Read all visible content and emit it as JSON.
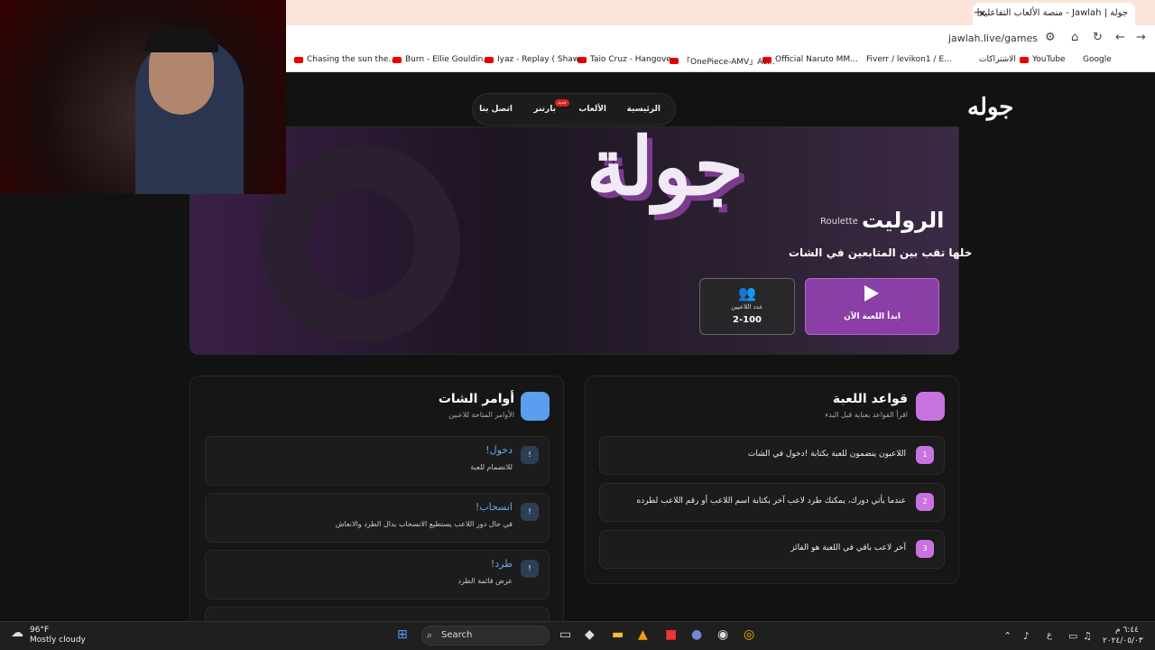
{
  "browser": {
    "tab_title": "جولة | Jawlah - منصة الألعاب التفاعلية",
    "tab_close": "✕",
    "new_tab": "+",
    "url": "jawlah.live/games",
    "bookmarks": [
      "Google",
      "YouTube",
      "الاشتراكات",
      "Fiverr / levikon1 / E...",
      "Official Naruto MM...",
      "「OnePiece-AMV」Ac...",
      "Taio Cruz - Hangove...",
      "Iyaz - Replay ( Shaw...",
      "Burn - Ellie Gouldin...",
      "Chasing the sun the..."
    ]
  },
  "site": {
    "logo": "جوله",
    "nav": [
      "الرئيسية",
      "الألعاب",
      "بارتنر",
      "اتصل بنا"
    ],
    "badge": "جديد"
  },
  "hero": {
    "watermark": "جولة",
    "title": "الروليت",
    "title_en": "Roulette",
    "subtitle": "خلها تقب بين المتابعين في الشات",
    "start_label": "ابدأ اللعبة الآن",
    "players_label": "عدد اللاعبين",
    "players_value": "2-100"
  },
  "rules": {
    "title": "قواعد اللعبة",
    "subtitle": "اقرأ القواعد بعناية قبل البدء",
    "items": [
      {
        "num": "1",
        "text": "اللاعبون ينضمون للعبة بكتابة !دخول في الشات"
      },
      {
        "num": "2",
        "text": "عندما يأتي دورك، يمكنك طرد لاعب آخر بكتابة اسم اللاعب أو رقم اللاعب لطرده"
      },
      {
        "num": "3",
        "text": "آخر لاعب باقي في اللعبة هو الفائز"
      }
    ]
  },
  "commands": {
    "title": "أوامر الشات",
    "subtitle": "الأوامر المتاحة للاعبين",
    "items": [
      {
        "num": "!",
        "cmd": "!دخول",
        "desc": "للانضمام للعبة"
      },
      {
        "num": "!",
        "cmd": "!انسحاب",
        "desc": "في حال دور اللاعب يستطيع الانسحاب بدال الطرد والانعاش"
      },
      {
        "num": "!",
        "cmd": "!طرد",
        "desc": "عرض قائمة الطرد"
      }
    ]
  },
  "taskbar": {
    "weather_temp": "96°F",
    "weather_desc": "Mostly cloudy",
    "search": "Search",
    "time": "٦:٤٤ م",
    "date": "٢٠٢٤/٠٥/٠٣",
    "lang": "ع"
  },
  "colors": {
    "accent": "#8a3fa6",
    "rules_icon": "#c873e0",
    "commands_icon": "#5b9ef0",
    "command_text": "#6aa8e8"
  }
}
